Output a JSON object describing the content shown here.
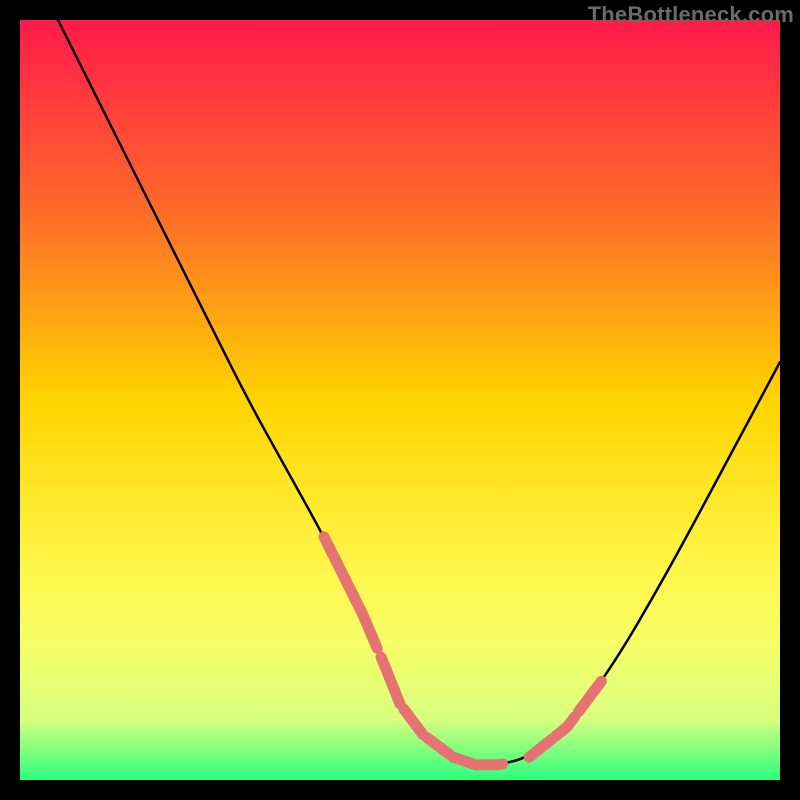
{
  "watermark": "TheBottleneck.com",
  "chart_data": {
    "type": "line",
    "title": "",
    "xlabel": "",
    "ylabel": "",
    "xlim": [
      0,
      100
    ],
    "ylim": [
      0,
      100
    ],
    "grid": false,
    "gradient_stops": [
      {
        "offset": 0,
        "color": "#ff1a4b"
      },
      {
        "offset": 25,
        "color": "#ff6a2a"
      },
      {
        "offset": 50,
        "color": "#ffd400"
      },
      {
        "offset": 72,
        "color": "#fff64a"
      },
      {
        "offset": 82,
        "color": "#f6ff66"
      },
      {
        "offset": 92,
        "color": "#d8ff80"
      },
      {
        "offset": 100,
        "color": "#2bff7a"
      }
    ],
    "series": [
      {
        "name": "bottleneck-curve",
        "x": [
          5,
          10,
          15,
          20,
          25,
          30,
          35,
          40,
          45,
          48,
          50,
          53,
          57,
          60,
          63,
          67,
          72,
          78,
          85,
          92,
          100
        ],
        "y": [
          100,
          90,
          80,
          70,
          60,
          50,
          41,
          32,
          22,
          15,
          10,
          6,
          3,
          2,
          2,
          3,
          7,
          15,
          27,
          40,
          55
        ]
      }
    ],
    "markers": {
      "name": "highlight-segments",
      "color": "#e57373",
      "segments_x": [
        [
          40,
          44
        ],
        [
          44,
          47
        ],
        [
          47.5,
          50
        ],
        [
          50.5,
          53
        ],
        [
          53.5,
          56.5
        ],
        [
          57,
          60
        ],
        [
          60.5,
          63.5
        ],
        [
          67,
          70
        ],
        [
          70.5,
          73
        ],
        [
          73.5,
          76.5
        ]
      ]
    }
  }
}
